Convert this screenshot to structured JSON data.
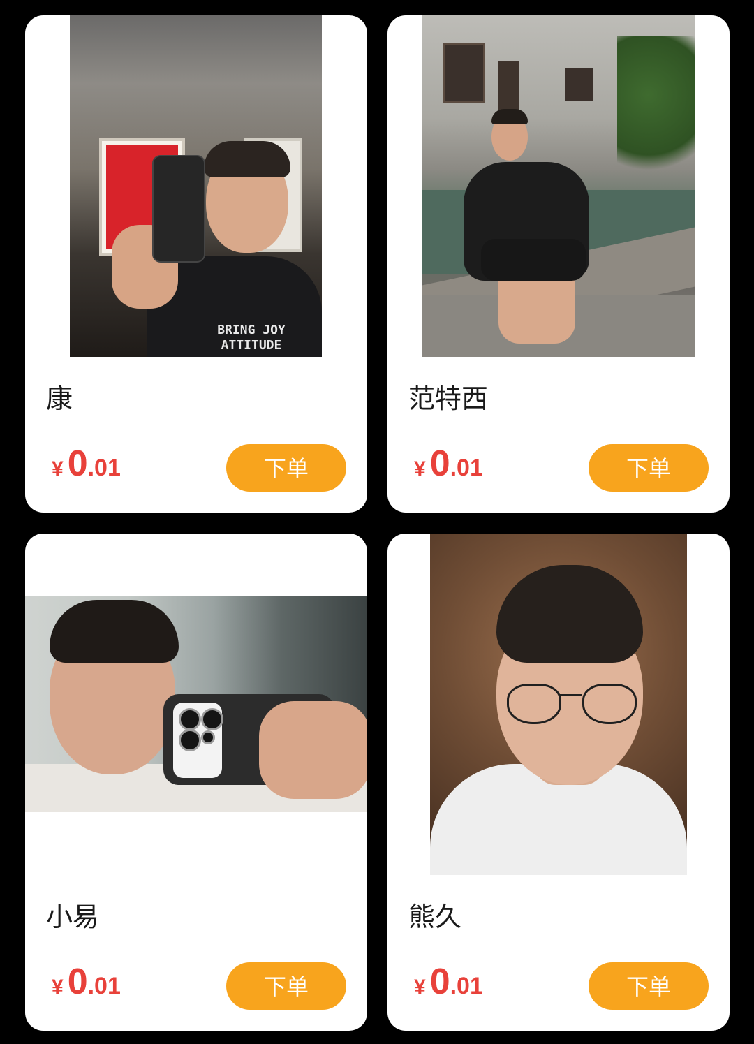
{
  "products": [
    {
      "name": "康",
      "price": {
        "currency": "¥",
        "integer": "0",
        "decimal": ".01"
      },
      "button_label": "下单"
    },
    {
      "name": "范特西",
      "price": {
        "currency": "¥",
        "integer": "0",
        "decimal": ".01"
      },
      "button_label": "下单"
    },
    {
      "name": "小易",
      "price": {
        "currency": "¥",
        "integer": "0",
        "decimal": ".01"
      },
      "button_label": "下单"
    },
    {
      "name": "熊久",
      "price": {
        "currency": "¥",
        "integer": "0",
        "decimal": ".01"
      },
      "button_label": "下单"
    }
  ],
  "shirt_text": "BRING JOY ATTITUDE",
  "colors": {
    "price_red": "#e8413a",
    "button_orange": "#f8a41d",
    "card_bg": "#ffffff",
    "page_bg": "#000000"
  }
}
